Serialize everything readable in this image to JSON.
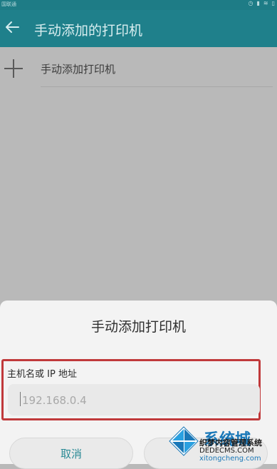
{
  "status_bar": {
    "carrier": "国联通",
    "icons": [
      "alarm-icon",
      "signal-icon",
      "wifi-icon",
      "battery-icon"
    ]
  },
  "header": {
    "title": "手动添加的打印机",
    "back_icon": "arrow-left-icon"
  },
  "list": {
    "items": [
      {
        "label": "手动添加打印机",
        "icon": "plus-icon"
      }
    ]
  },
  "dialog": {
    "title": "手动添加打印机",
    "field_label": "主机名或 IP 地址",
    "input_placeholder": "192.168.0.4",
    "input_value": "",
    "cancel_label": "取消",
    "confirm_label": ""
  },
  "watermark": {
    "text1": "系统城",
    "text2": "织梦内容管理系统",
    "text3": "DEDECMS.COM",
    "text4": "xitongcheng.com"
  },
  "colors": {
    "header_bg": "#1f808b",
    "status_bg": "#1e7c86",
    "overlay": "#b9b9b9",
    "dialog_bg": "#f3f3f3",
    "highlight_border": "#c0393b",
    "accent_text": "#2a8a95"
  }
}
